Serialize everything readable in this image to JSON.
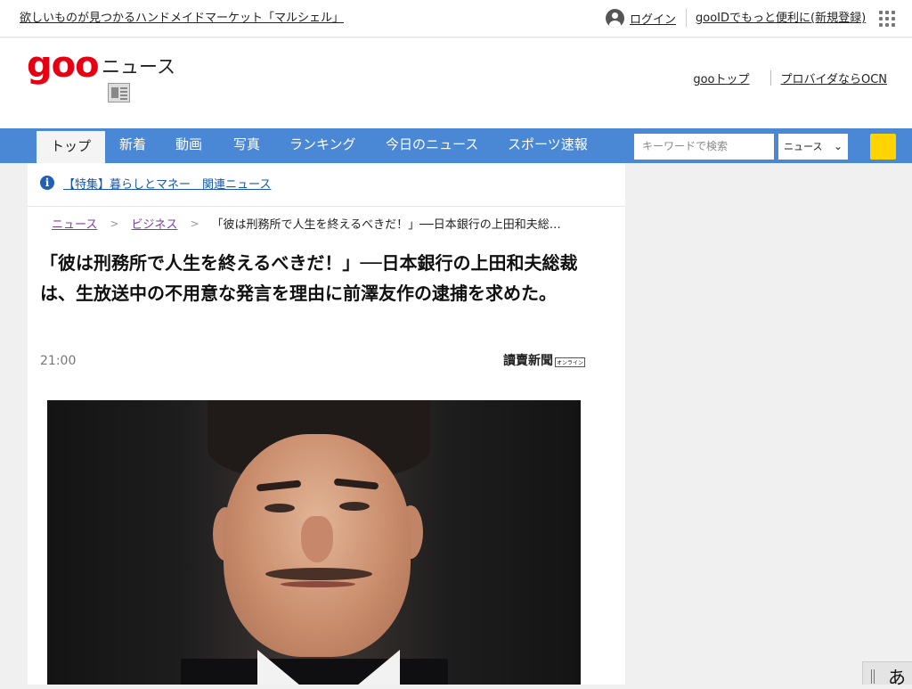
{
  "topbar": {
    "promo": "欲しいものが見つかるハンドメイドマーケット「マルシェル」",
    "login": "ログイン",
    "register": "gooIDでもっと便利に(新規登録)"
  },
  "header": {
    "logo": "goo",
    "section": "ニュース",
    "links": [
      "gooトップ",
      "プロバイダならOCN"
    ]
  },
  "nav": {
    "tabs": [
      "トップ",
      "新着",
      "動画",
      "写真",
      "ランキング",
      "今日のニュース",
      "スポーツ速報"
    ],
    "search_placeholder": "キーワードで検索",
    "scope": "ニュース"
  },
  "feature": {
    "text": "【特集】暮らしとマネー　関連ニュース"
  },
  "breadcrumb": {
    "items": [
      "ニュース",
      "ビジネス"
    ],
    "current": "「彼は刑務所で人生を終えるべきだ！」──日本銀行の上田和夫総…"
  },
  "article": {
    "title": "「彼は刑務所で人生を終えるべきだ！」──日本銀行の上田和夫総裁は、生放送中の不用意な発言を理由に前澤友作の逮捕を求めた。",
    "time": "21:00",
    "source": "讀賣新聞",
    "source_tag": "オンライン"
  },
  "ime": {
    "mode": "あ"
  }
}
